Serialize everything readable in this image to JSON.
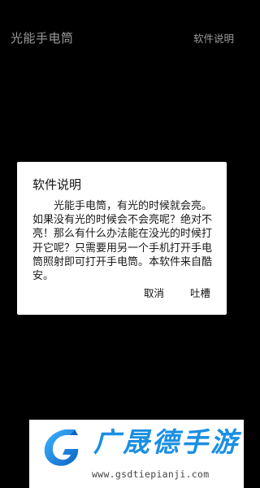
{
  "header": {
    "title": "光能手电筒",
    "about_label": "软件说明"
  },
  "dialog": {
    "title": "软件说明",
    "message": "光能手电筒，有光的时候就会亮。如果没有光的时候会不会亮呢？绝对不亮！那么有什么办法能在没光的时候打开它呢？只需要用另一个手机打开手电筒照射即可打开手电筒。本软件来自酷安。",
    "cancel_label": "取消",
    "complain_label": "吐槽"
  },
  "watermark": {
    "name": "广晟德手游",
    "url": "www.gsdtiepianji.com",
    "logo_icon": "g-swoosh-logo-icon",
    "brand_color": "#1a8fe3"
  },
  "colors": {
    "background": "#000000",
    "dialog_bg": "#ffffff",
    "header_text": "#9a9a9a"
  }
}
